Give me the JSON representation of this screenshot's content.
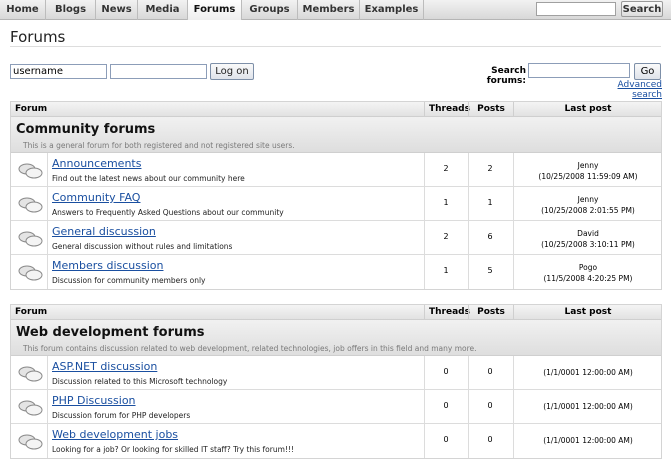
{
  "nav": {
    "tabs": [
      "Home",
      "Blogs",
      "News",
      "Media",
      "Forums",
      "Groups",
      "Members",
      "Examples"
    ],
    "active": "Forums",
    "search_button": "Search"
  },
  "page": {
    "title": "Forums"
  },
  "logon": {
    "username_value": "username",
    "button": "Log on"
  },
  "forum_search": {
    "label": "Search forums:",
    "go_button": "Go",
    "advanced_link": "Advanced search"
  },
  "columns": {
    "forum": "Forum",
    "threads": "Threads",
    "posts": "Posts",
    "last_post": "Last post"
  },
  "groups": [
    {
      "name": "Community forums",
      "description": "This is a general forum for both registered and not registered site users.",
      "forums": [
        {
          "name": "Announcements",
          "description": "Find out the latest news about our community here",
          "threads": "2",
          "posts": "2",
          "last_user": "Jenny",
          "last_date": "(10/25/2008 11:59:09 AM)"
        },
        {
          "name": "Community FAQ",
          "description": "Answers to Frequently Asked Questions about our community",
          "threads": "1",
          "posts": "1",
          "last_user": "Jenny",
          "last_date": "(10/25/2008 2:01:55 PM)"
        },
        {
          "name": "General discussion",
          "description": "General discussion without rules and limitations",
          "threads": "2",
          "posts": "6",
          "last_user": "David",
          "last_date": "(10/25/2008 3:10:11 PM)"
        },
        {
          "name": "Members discussion",
          "description": "Discussion for community members only",
          "threads": "1",
          "posts": "5",
          "last_user": "Pogo",
          "last_date": "(11/5/2008 4:20:25 PM)"
        }
      ]
    },
    {
      "name": "Web development forums",
      "description": "This forum contains discussion related to web development, related technologies, job offers in this field and many more.",
      "forums": [
        {
          "name": "ASP.NET discussion",
          "description": "Discussion related to this Microsoft technology",
          "threads": "0",
          "posts": "0",
          "last_user": "",
          "last_date": "(1/1/0001 12:00:00 AM)"
        },
        {
          "name": "PHP Discussion",
          "description": "Discussion forum for PHP developers",
          "threads": "0",
          "posts": "0",
          "last_user": "",
          "last_date": "(1/1/0001 12:00:00 AM)"
        },
        {
          "name": "Web development jobs",
          "description": "Looking for a job? Or looking for skilled IT staff? Try this forum!!!",
          "threads": "0",
          "posts": "0",
          "last_user": "",
          "last_date": "(1/1/0001 12:00:00 AM)"
        }
      ]
    }
  ]
}
